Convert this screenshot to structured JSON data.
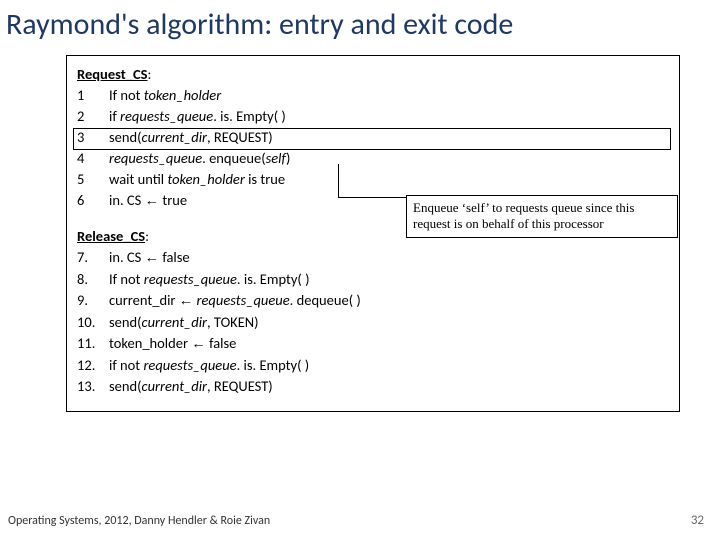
{
  "title": "Raymond's algorithm: entry and exit code",
  "request": {
    "heading": "Request_CS",
    "lines": [
      {
        "n": "1",
        "pre": "If not ",
        "ital": "token_holder",
        "post": "",
        "indent": 1
      },
      {
        "n": "2",
        "pre": "if ",
        "ital": "requests_queue",
        "post": ". is. Empty( )",
        "indent": 2
      },
      {
        "n": "3",
        "pre": "send(",
        "ital": "current_dir",
        "post": ", REQUEST)",
        "indent": 3
      },
      {
        "n": "4",
        "pre": "",
        "ital": "requests_queue",
        "post": ". enqueue(",
        "ital2": "self",
        "post2": ")",
        "indent": 2
      },
      {
        "n": "5",
        "pre": "wait until ",
        "ital": "token_holder",
        "post": " is true",
        "indent": 2
      },
      {
        "n": "6",
        "pre": "in. CS ",
        "arrow": "←",
        "post": " true",
        "indent": 1
      }
    ]
  },
  "release": {
    "heading": "Release_CS",
    "lines": [
      {
        "n": "7.",
        "pre": "in. CS ",
        "arrow": "←",
        "post": " false",
        "indent": 1
      },
      {
        "n": "8.",
        "pre": "If not ",
        "ital": "requests_queue",
        "post": ". is. Empty( )",
        "indent": 1
      },
      {
        "n": "9.",
        "pre": "current_dir ",
        "arrow": "←",
        "post": " ",
        "ital": "requests_queue",
        "post2": ". dequeue( )",
        "indent": 2
      },
      {
        "n": "10.",
        "pre": "send(",
        "ital": "current_dir",
        "post": ", TOKEN)",
        "indent": 2
      },
      {
        "n": "11.",
        "pre": "token_holder ",
        "arrow": "←",
        "post": " false",
        "indent": 2
      },
      {
        "n": "12.",
        "pre": "if not ",
        "ital": "requests_queue",
        "post": ". is. Empty( )",
        "indent": 2
      },
      {
        "n": "13.",
        "pre": "send(",
        "ital": "current_dir",
        "post": ", REQUEST)",
        "indent": 3
      }
    ]
  },
  "callout": "Enqueue ‘self’ to requests queue since this request is on behalf of this processor",
  "footer": "Operating Systems, 2012, Danny Hendler & Roie Zivan",
  "pagenum": "32"
}
